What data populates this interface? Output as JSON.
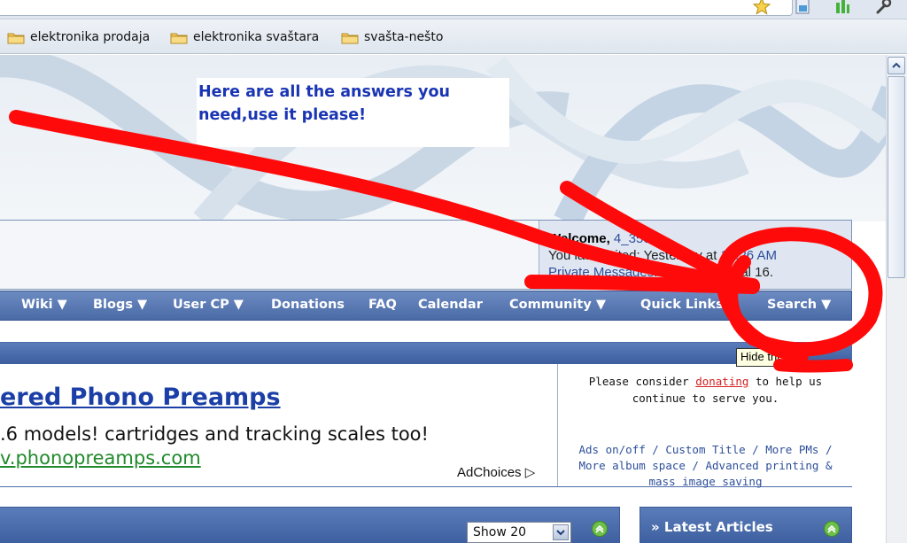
{
  "bookmarks": [
    {
      "label": "elektronika prodaja"
    },
    {
      "label": "elektronika svaštara"
    },
    {
      "label": "svašta-nešto"
    }
  ],
  "banner": {
    "note": "Here are all the answers you need,use it please!"
  },
  "welcome": {
    "greeting": "Welcome,",
    "username": "4_350",
    "last_visited_prefix": "You last visited: Yesterday at",
    "last_visited_time": "10:26 AM",
    "private_messages": "Private Messages",
    "pm_counts": "Unread 0, Total 16."
  },
  "navbar": {
    "items": [
      {
        "label": "Wiki ▼"
      },
      {
        "label": "Blogs ▼"
      },
      {
        "label": "User CP ▼"
      },
      {
        "label": "Donations"
      },
      {
        "label": "FAQ"
      },
      {
        "label": "Calendar"
      },
      {
        "label": "Community ▼"
      },
      {
        "label": "Quick Links ▼"
      },
      {
        "label": "Search ▼"
      }
    ]
  },
  "ad": {
    "title": "ered Phono Preamps",
    "text": ".6 models! cartridges and tracking scales too!",
    "url": "v.phonopreamps.com",
    "adchoices": "AdChoices ▷"
  },
  "donate": {
    "line1_prefix": "Please consider",
    "line1_link": "donating",
    "line1_suffix": "to help us",
    "line2": "continue to serve you.",
    "links_line1": "Ads on/off / Custom Title / More PMs /",
    "links_line2": "More album space / Advanced printing &",
    "links_line3": "mass image saving",
    "tooltip": "Hide this!"
  },
  "box2": {
    "show_value": "Show 20"
  },
  "box3": {
    "title": "» Latest Articles"
  },
  "colors": {
    "navbar": "#4a6aa6",
    "annotation_red": "#ff0000",
    "note_text": "#1a35b3"
  }
}
